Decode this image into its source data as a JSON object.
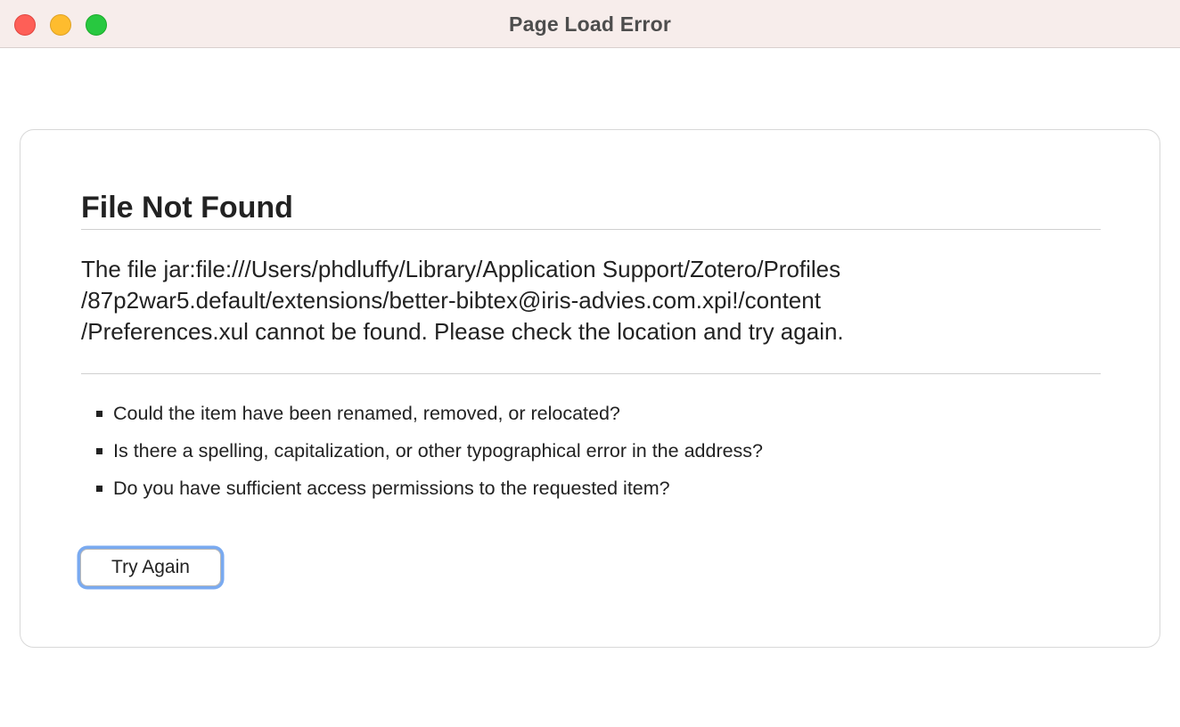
{
  "window": {
    "title": "Page Load Error",
    "controls": {
      "close": "close-icon",
      "minimize": "minimize-icon",
      "zoom": "zoom-icon"
    }
  },
  "error": {
    "title": "File Not Found",
    "description_lines": [
      "The file jar:file:///Users/phdluffy/Library/Application Support/Zotero/Profiles",
      "/87p2war5.default/extensions/better-bibtex@iris-advies.com.xpi!/content",
      "/Preferences.xul cannot be found. Please check the location and try again."
    ],
    "suggestions": [
      "Could the item have been renamed, removed, or relocated?",
      "Is there a spelling, capitalization, or other typographical error in the address?",
      "Do you have sufficient access permissions to the requested item?"
    ],
    "try_again_label": "Try Again"
  },
  "colors": {
    "titlebar": "#f7edeb",
    "close": "#fe5f57",
    "minimize": "#febc2e",
    "zoom": "#28c840",
    "focus_ring": "#7aaaf0",
    "text": "#222222"
  }
}
